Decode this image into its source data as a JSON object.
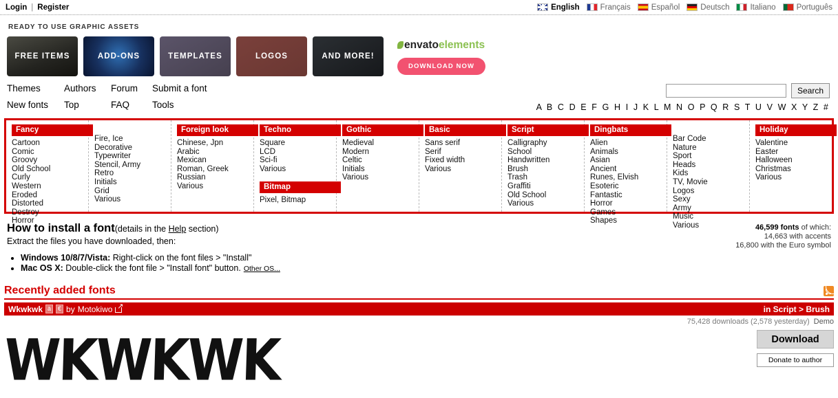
{
  "topbar": {
    "login": "Login",
    "separator": "|",
    "register": "Register",
    "languages": [
      {
        "label": "English",
        "flag": "flag-en-icon",
        "active": true
      },
      {
        "label": "Français",
        "flag": "flag-fr-icon",
        "active": false
      },
      {
        "label": "Español",
        "flag": "flag-es-icon",
        "active": false
      },
      {
        "label": "Deutsch",
        "flag": "flag-de-icon",
        "active": false
      },
      {
        "label": "Italiano",
        "flag": "flag-it-icon",
        "active": false
      },
      {
        "label": "Português",
        "flag": "flag-pt-icon",
        "active": false
      }
    ]
  },
  "ad": {
    "kicker": "READY TO USE GRAPHIC ASSETS",
    "cards": [
      {
        "label": "FREE ITEMS"
      },
      {
        "label": "ADD-ONS"
      },
      {
        "label": "TEMPLATES"
      },
      {
        "label": "LOGOS"
      },
      {
        "label": "AND MORE!"
      }
    ],
    "brand_dark": "envato",
    "brand_light": "elements",
    "cta": "DOWNLOAD NOW"
  },
  "nav": {
    "items": [
      "Themes",
      "Authors",
      "Forum",
      "Submit a font",
      "New fonts",
      "Top",
      "FAQ",
      "Tools"
    ]
  },
  "search": {
    "value": "",
    "placeholder": "",
    "button": "Search",
    "alphabet": "A B C D E F G H I J K L M N O P Q R S T U V W X Y Z #"
  },
  "categories": [
    {
      "heading": "Fancy",
      "items": [
        "Cartoon",
        "Comic",
        "Groovy",
        "Old School",
        "Curly",
        "Western",
        "Eroded",
        "Distorted",
        "Destroy",
        "Horror"
      ]
    },
    {
      "heading": "",
      "items": [
        "Fire, Ice",
        "Decorative",
        "Typewriter",
        "Stencil, Army",
        "Retro",
        "Initials",
        "Grid",
        "Various"
      ]
    },
    {
      "heading": "Foreign look",
      "items": [
        "Chinese, Jpn",
        "Arabic",
        "Mexican",
        "Roman, Greek",
        "Russian",
        "Various"
      ]
    },
    {
      "heading": "Techno",
      "items": [
        "Square",
        "LCD",
        "Sci-fi",
        "Various"
      ],
      "heading2": "Bitmap",
      "items2": [
        "Pixel, Bitmap"
      ]
    },
    {
      "heading": "Gothic",
      "items": [
        "Medieval",
        "Modern",
        "Celtic",
        "Initials",
        "Various"
      ]
    },
    {
      "heading": "Basic",
      "items": [
        "Sans serif",
        "Serif",
        "Fixed width",
        "Various"
      ]
    },
    {
      "heading": "Script",
      "items": [
        "Calligraphy",
        "School",
        "Handwritten",
        "Brush",
        "Trash",
        "Graffiti",
        "Old School",
        "Various"
      ]
    },
    {
      "heading": "Dingbats",
      "items": [
        "Alien",
        "Animals",
        "Asian",
        "Ancient",
        "Runes, Elvish",
        "Esoteric",
        "Fantastic",
        "Horror",
        "Games",
        "Shapes"
      ]
    },
    {
      "heading": "",
      "items": [
        "Bar Code",
        "Nature",
        "Sport",
        "Heads",
        "Kids",
        "TV, Movie",
        "Logos",
        "Sexy",
        "Army",
        "Music",
        "Various"
      ]
    },
    {
      "heading": "Holiday",
      "items": [
        "Valentine",
        "Easter",
        "Halloween",
        "Christmas",
        "Various"
      ]
    }
  ],
  "install": {
    "title": "How to install a font",
    "sub_before": "(details in the ",
    "sub_link": "Help",
    "sub_after": " section)",
    "extract": "Extract the files you have downloaded, then:",
    "steps": [
      {
        "os": "Windows 10/8/7/Vista:",
        "text": " Right-click on the font files > \"Install\""
      },
      {
        "os": "Mac OS X:",
        "text": " Double-click the font file > \"Install font\" button."
      }
    ],
    "other_os": "Other OS..."
  },
  "counts": {
    "total": "46,599 fonts",
    "total_suffix": " of which:",
    "accents": "14,663 with accents",
    "euro": "16,800 with the Euro symbol"
  },
  "recent": {
    "title": "Recently added fonts",
    "rss": "rss-icon",
    "font_name": "Wkwkwk",
    "badge_accents": "à",
    "badge_euro": "€",
    "by": "by",
    "author": "Motokiwo",
    "external": "external-link-icon",
    "category": "in Script > Brush",
    "downloads": "75,428 downloads (2,578 yesterday)",
    "demo": "Demo",
    "preview_text": "WKWKWK",
    "download_button": "Download",
    "donate_button": "Donate to author"
  }
}
